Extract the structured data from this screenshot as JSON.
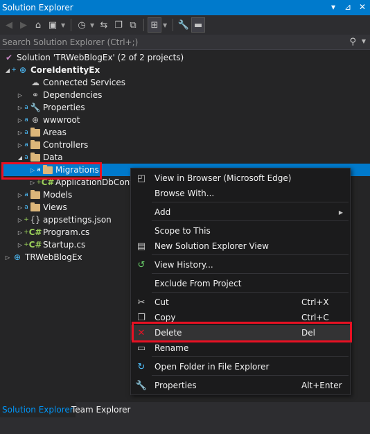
{
  "window": {
    "title": "Solution Explorer",
    "pin_glyph": "▾",
    "pin2_glyph": "⊿",
    "close_glyph": "✕"
  },
  "search": {
    "placeholder": "Search Solution Explorer (Ctrl+;)"
  },
  "tree": {
    "solution": "Solution 'TRWebBlogEx' (2 of 2 projects)",
    "project1": "CoreIdentityEx",
    "items": {
      "connected": "Connected Services",
      "dependencies": "Dependencies",
      "properties": "Properties",
      "wwwroot": "wwwroot",
      "areas": "Areas",
      "controllers": "Controllers",
      "data": "Data",
      "migrations": "Migrations",
      "appdbcontext": "ApplicationDbConte",
      "models": "Models",
      "views": "Views",
      "appsettings": "appsettings.json",
      "program": "Program.cs",
      "startup": "Startup.cs"
    },
    "project2": "TRWebBlogEx",
    "cs_glyph": "C#"
  },
  "menu": {
    "view_browser": "View in Browser (Microsoft Edge)",
    "browse_with": "Browse With...",
    "add": "Add",
    "scope": "Scope to This",
    "new_view": "New Solution Explorer View",
    "history": "View History...",
    "exclude": "Exclude From Project",
    "cut": "Cut",
    "cut_sc": "Ctrl+X",
    "copy": "Copy",
    "copy_sc": "Ctrl+C",
    "delete": "Delete",
    "delete_sc": "Del",
    "rename": "Rename",
    "open_folder": "Open Folder in File Explorer",
    "properties": "Properties",
    "properties_sc": "Alt+Enter"
  },
  "tabs": {
    "solution": "Solution Explorer",
    "team": "Team Explorer"
  },
  "colors": {
    "accent": "#007acc",
    "highlight_red": "#e81123",
    "folder": "#dcb67a"
  }
}
